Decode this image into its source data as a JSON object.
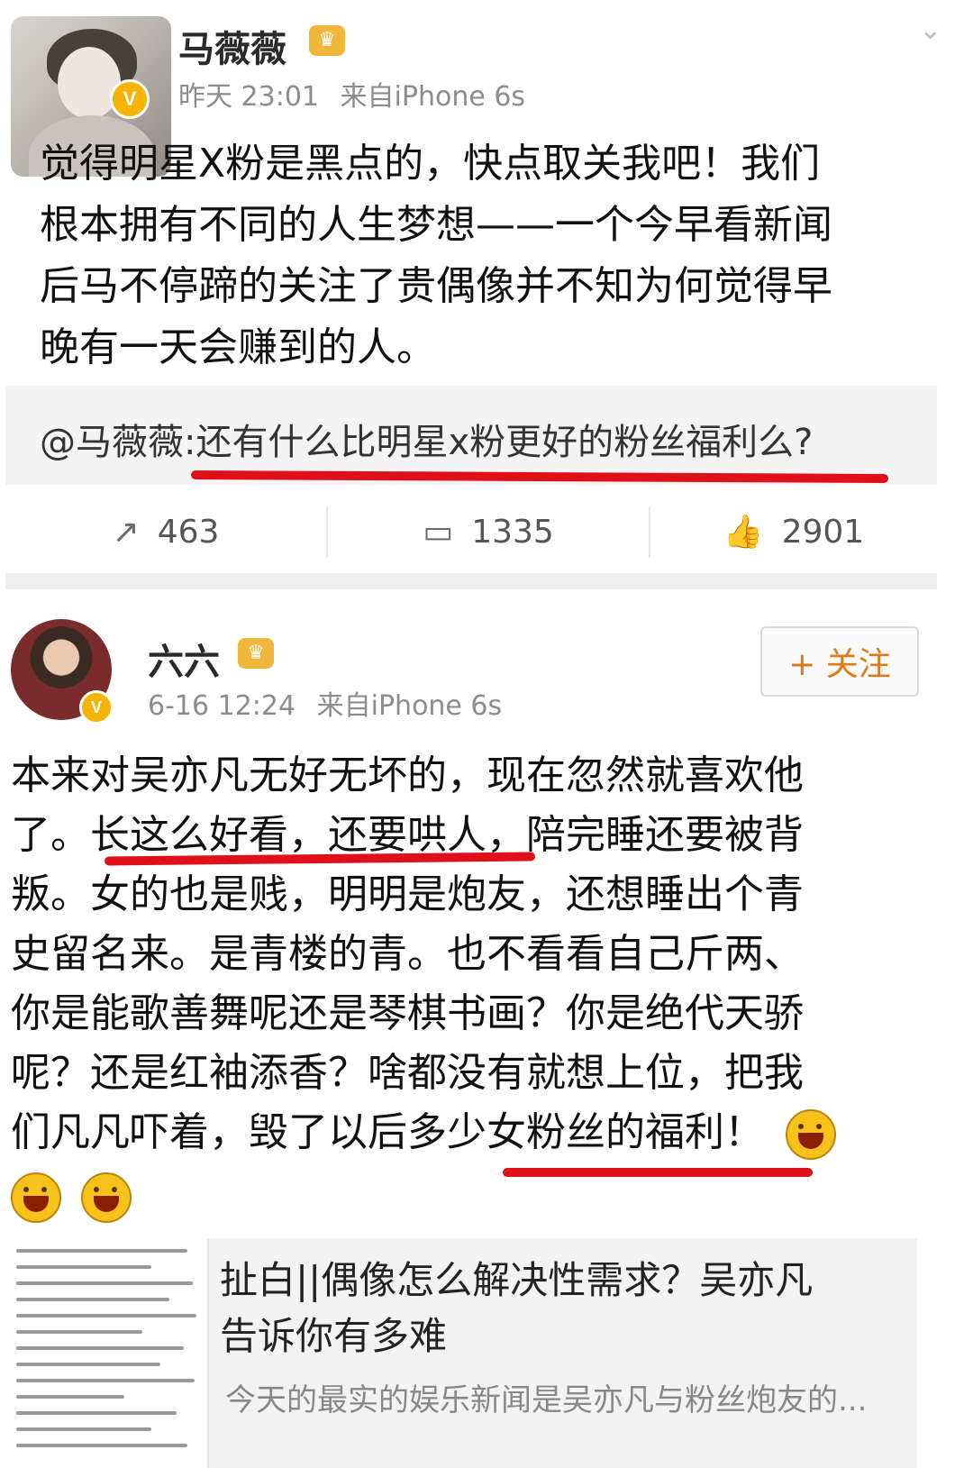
{
  "post1": {
    "username": "马薇薇",
    "verified_badge": "V",
    "crown_icon": "crown-icon",
    "time": "昨天 23:01",
    "source": "来自iPhone 6s",
    "text_lines": [
      "觉得明星X粉是黑点的，快点取关我吧！我们",
      "根本拥有不同的人生梦想——一个今早看新闻",
      "后马不停蹄的关注了贵偶像并不知为何觉得早",
      "晚有一天会赚到的人。"
    ],
    "repost_text": "@马薇薇:还有什么比明星x粉更好的粉丝福利么?",
    "actions": {
      "repost_count": "463",
      "comment_count": "1335",
      "like_count": "2901"
    }
  },
  "post2": {
    "username": "六六",
    "verified_badge": "V",
    "time": "6-16 12:24",
    "source": "来自iPhone 6s",
    "follow_label": "+ 关注",
    "text_lines": [
      "本来对吴亦凡无好无坏的，现在忽然就喜欢他",
      "了。长这么好看，还要哄人，陪完睡还要被背",
      "叛。女的也是贱，明明是炮友，还想睡出个青",
      "史留名来。是青楼的青。也不看看自己斤两、",
      "你是能歌善舞呢还是琴棋书画？你是绝代天骄",
      "呢？还是红袖添香？啥都没有就想上位，把我",
      "们凡凡吓着，毁了以后多少女粉丝的福利！"
    ],
    "emoji_name": "laughing-emoji"
  },
  "card": {
    "title_lines": [
      "扯白||偶像怎么解决性需求？吴亦凡",
      "告诉你有多难"
    ],
    "description": "今天的最实的娱乐新闻是吴亦凡与粉丝炮友的..."
  },
  "colors": {
    "highlight_underline": "#e0101a",
    "vip_badge": "#f5b400",
    "follow_text": "#e07a18",
    "meta_text": "#8c8c8c"
  }
}
